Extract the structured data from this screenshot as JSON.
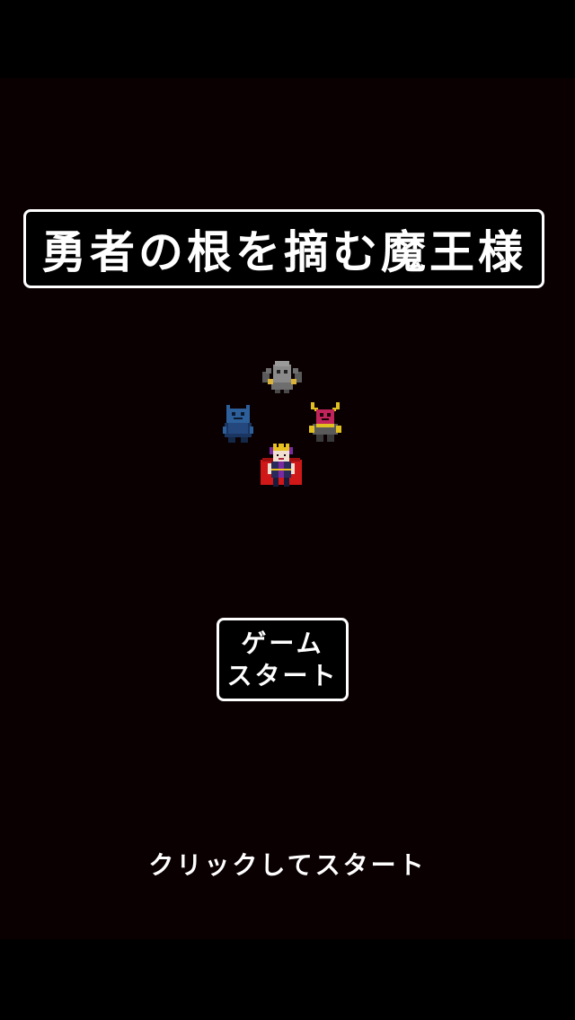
{
  "title": "勇者の根を摘む魔王様",
  "start_button": {
    "line1": "ゲーム",
    "line2": "スタート"
  },
  "hint": "クリックしてスタート",
  "characters": [
    {
      "name": "gargoyle-sprite",
      "colors": {
        "body": "#8a8a8a",
        "accent": "#d8b23a"
      }
    },
    {
      "name": "blue-beast-sprite",
      "colors": {
        "body": "#2d5f9a",
        "accent": "#1a3560"
      }
    },
    {
      "name": "horned-demon-sprite",
      "colors": {
        "body": "#c0245a",
        "accent": "#e0c020"
      }
    },
    {
      "name": "demon-lord-sprite",
      "colors": {
        "cape": "#d01818",
        "crown": "#e8c020",
        "robe": "#7a2aa0"
      }
    }
  ],
  "colors": {
    "background": "#0a0002",
    "frame": "#000000",
    "text": "#ffffff"
  }
}
